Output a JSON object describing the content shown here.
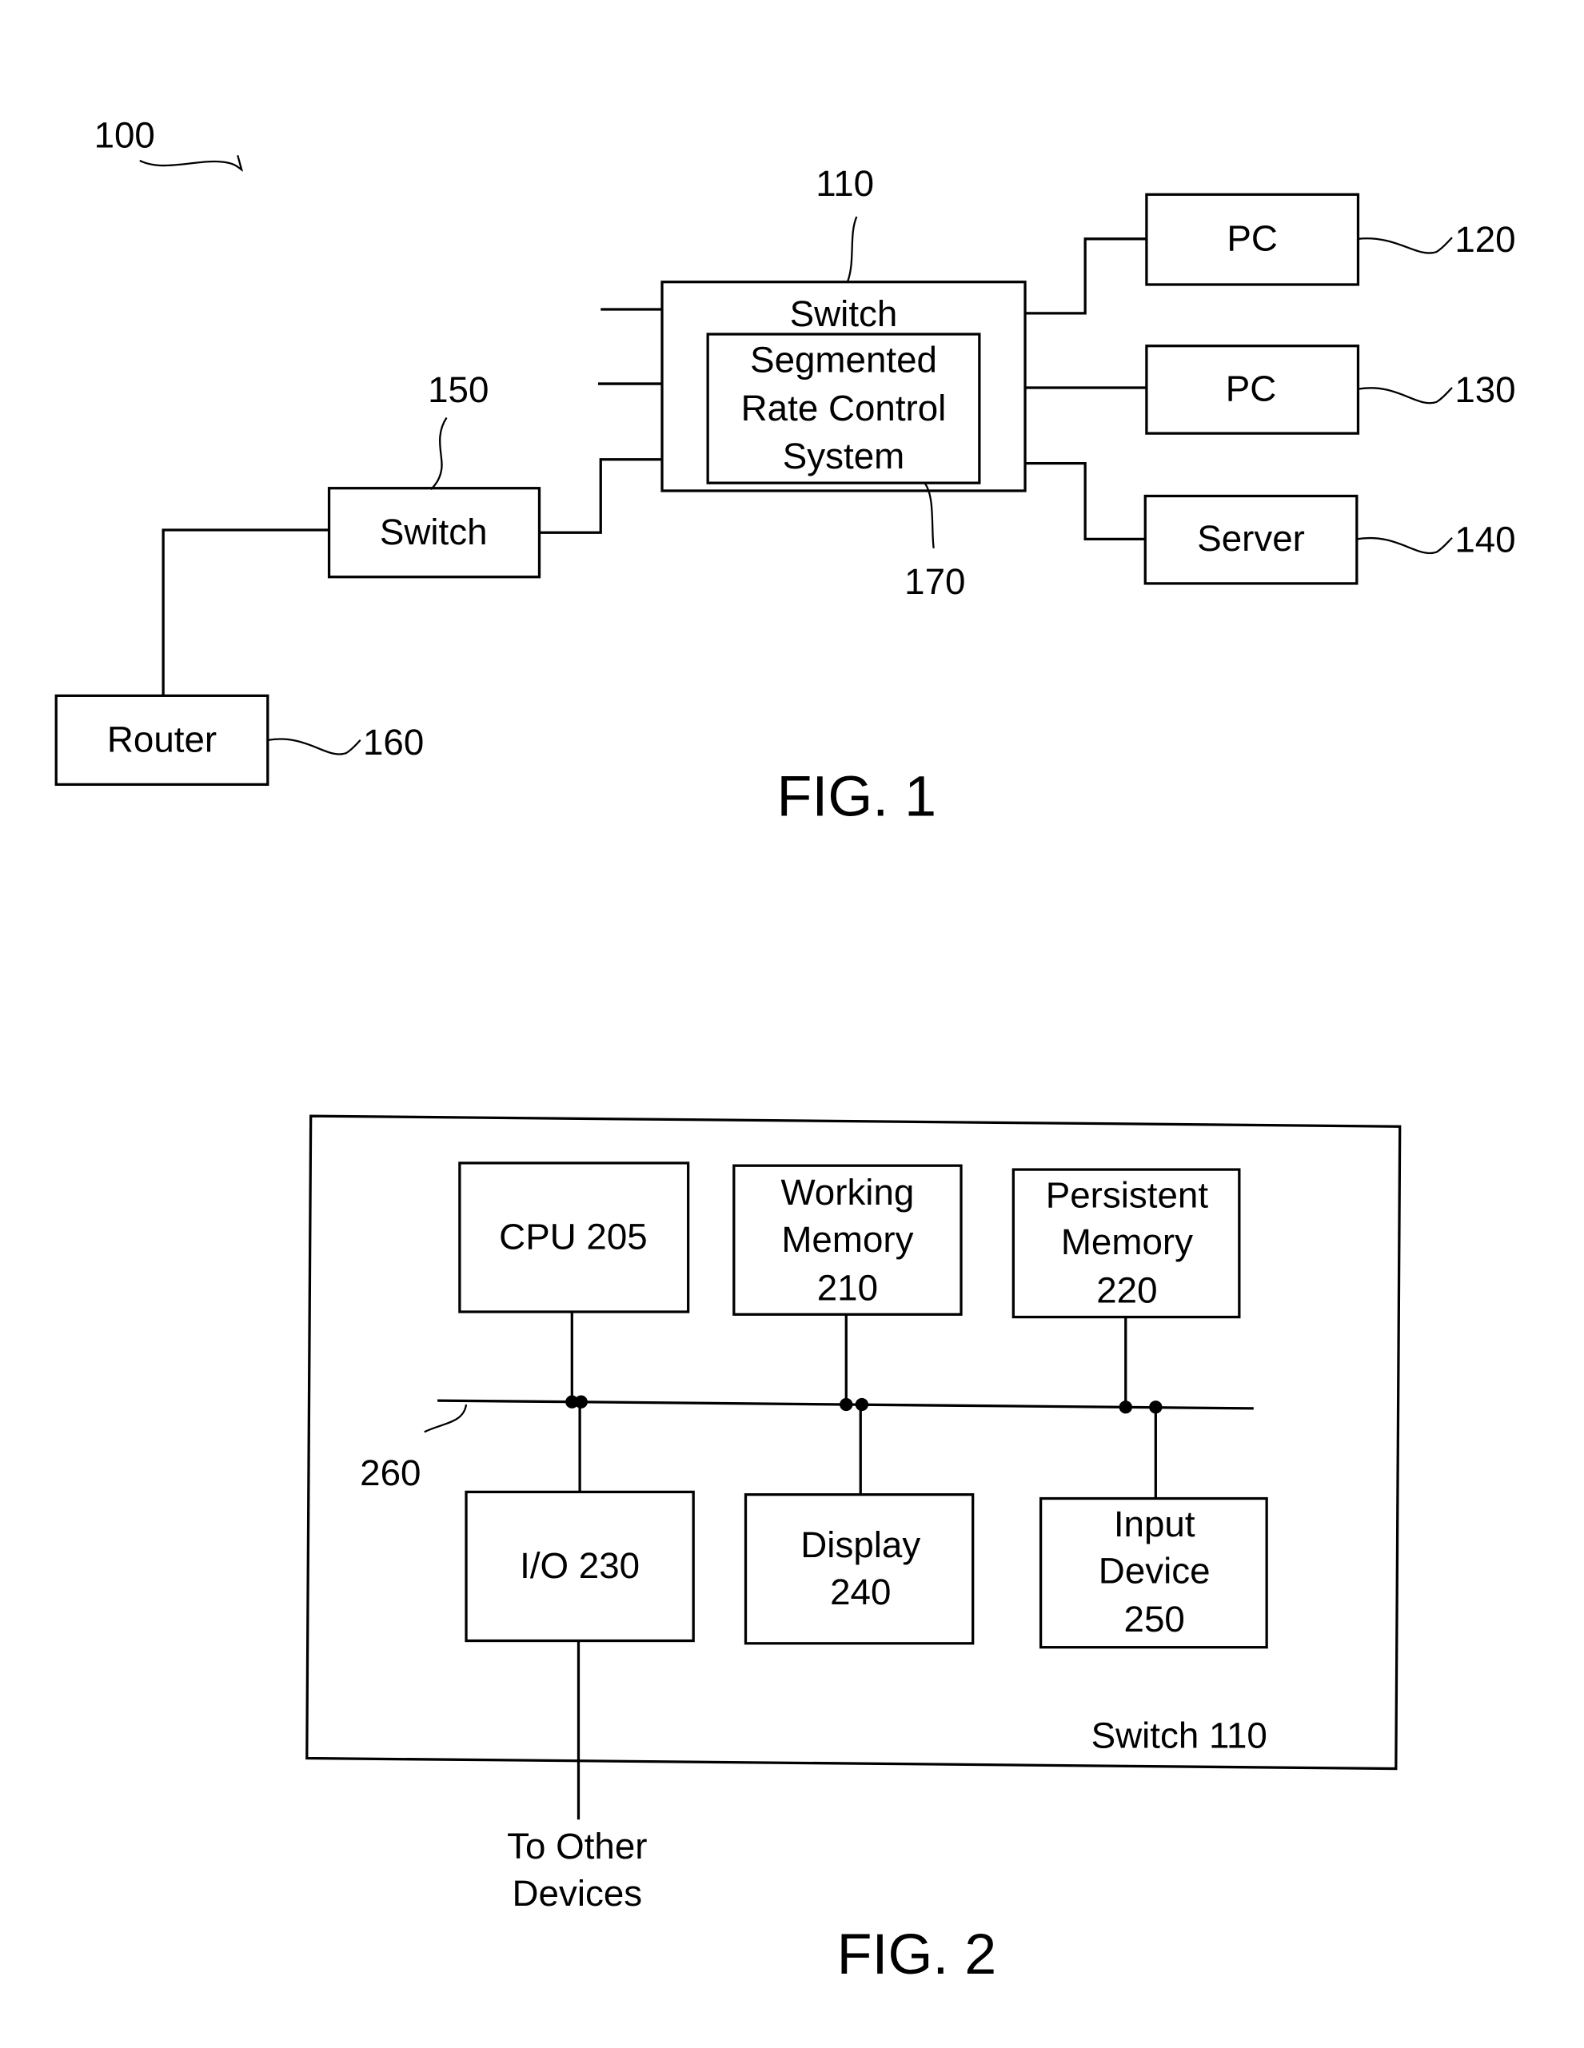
{
  "fig1": {
    "ref_label": "100",
    "caption": "FIG. 1",
    "switch_main": {
      "label": "Switch",
      "ref": "110"
    },
    "rate_control": {
      "lines": [
        "Segmented",
        "Rate Control",
        "System"
      ],
      "ref": "170"
    },
    "pc1": {
      "label": "PC",
      "ref": "120"
    },
    "pc2": {
      "label": "PC",
      "ref": "130"
    },
    "server": {
      "label": "Server",
      "ref": "140"
    },
    "switch2": {
      "label": "Switch",
      "ref": "150"
    },
    "router": {
      "label": "Router",
      "ref": "160"
    }
  },
  "fig2": {
    "caption": "FIG. 2",
    "container_label": "Switch 110",
    "bus_ref": "260",
    "cpu": {
      "lines": [
        "CPU 205"
      ]
    },
    "working_memory": {
      "lines": [
        "Working",
        "Memory",
        "210"
      ]
    },
    "persistent_memory": {
      "lines": [
        "Persistent",
        "Memory",
        "220"
      ]
    },
    "io": {
      "lines": [
        "I/O 230"
      ]
    },
    "display": {
      "lines": [
        "Display",
        "240"
      ]
    },
    "input_device": {
      "lines": [
        "Input",
        "Device",
        "250"
      ]
    },
    "external": {
      "lines": [
        "To Other",
        "Devices"
      ]
    }
  }
}
